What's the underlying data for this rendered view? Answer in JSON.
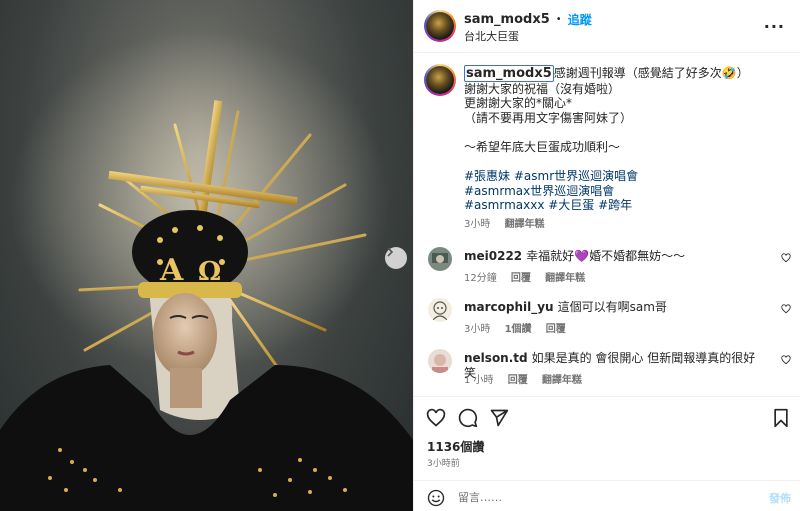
{
  "post": {
    "username": "sam_modx5",
    "follow_label": "追蹤",
    "dot": "•",
    "location": "台北大巨蛋",
    "more_icon": "more-horizontal-icon"
  },
  "caption": {
    "username": "sam_modx5",
    "lines": [
      "感謝週刊報導（感覺結了好多次🤣）",
      "謝謝大家的祝福（沒有婚啦）",
      "更謝謝大家的*關心*",
      "（請不要再用文字傷害阿妹了）",
      "",
      "～希望年底大巨蛋成功順利～",
      ""
    ],
    "hashtags": [
      "#張惠妹 #asmr世界巡迴演唱會",
      "#asmrmax世界巡迴演唱會",
      "#asmrmaxxx #大巨蛋 #跨年"
    ],
    "time": "3小時",
    "see_translation": "翻譯年糕"
  },
  "comments": [
    {
      "username": "mei0222",
      "text": "幸福就好💜婚不婚都無妨～～",
      "time": "12分鐘",
      "reply": "回覆",
      "translate": "翻譯年糕",
      "likes": ""
    },
    {
      "username": "marcophil_yu",
      "text": "這個可以有啊sam哥",
      "time": "3小時",
      "likes": "1個讚",
      "reply": "回覆",
      "translate": ""
    },
    {
      "username": "nelson.td",
      "text": "如果是真的 會很開心 但新聞報導真的很好笑",
      "time": "1 小時",
      "reply": "回覆",
      "translate": "翻譯年糕",
      "likes": ""
    }
  ],
  "actions": {
    "icons": [
      "heart-icon",
      "comment-icon",
      "share-icon",
      "bookmark-icon"
    ]
  },
  "likes_count": "1136個讚",
  "posted_time": "3小時前",
  "composer": {
    "placeholder": "留言……",
    "post_label": "發佈"
  },
  "colors": {
    "accent": "#0095f6",
    "hashtag": "#00376b",
    "muted": "#737373",
    "post_disabled": "#b2dffc"
  }
}
